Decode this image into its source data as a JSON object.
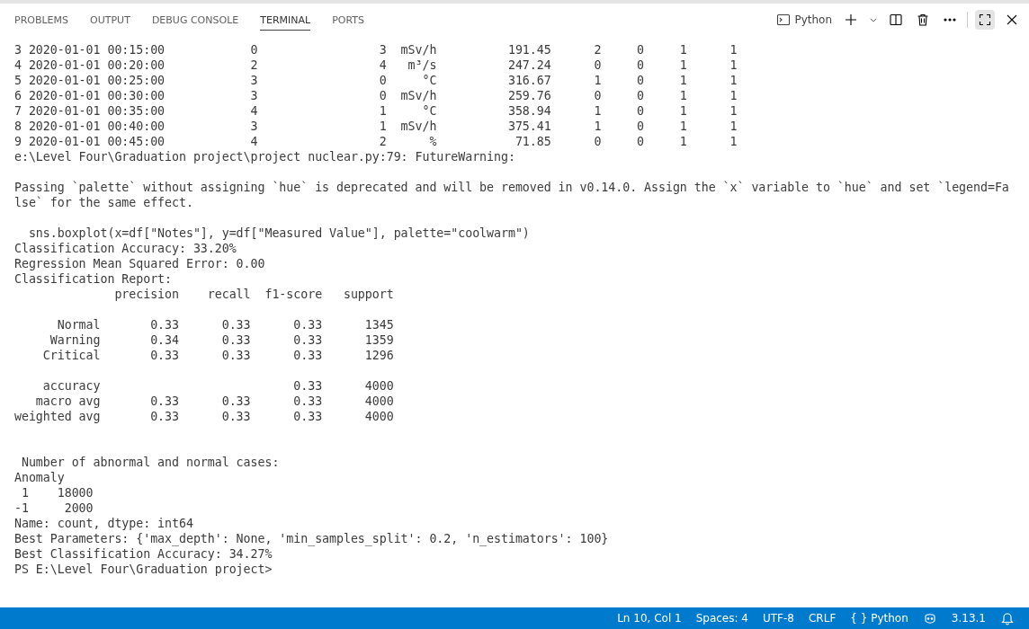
{
  "panel_tabs": [
    {
      "label": "PROBLEMS",
      "selected": false
    },
    {
      "label": "OUTPUT",
      "selected": false
    },
    {
      "label": "DEBUG CONSOLE",
      "selected": false
    },
    {
      "label": "TERMINAL",
      "selected": true
    },
    {
      "label": "PORTS",
      "selected": false
    }
  ],
  "terminal_profile": "Python",
  "terminal_blocks": [
    [
      {
        "text": "3 2020-01-01 00:15:00            0                 3  mSv/h          191.45      2     0     1      1"
      },
      {
        "text": "4 2020-01-01 00:20:00            2                 4   m³/s          247.24      0     0     1      1"
      },
      {
        "text": "5 2020-01-01 00:25:00            3                 0     °C          316.67      1     0     1      1"
      },
      {
        "text": "6 2020-01-01 00:30:00            3                 0  mSv/h          259.76      0     0     1      1"
      },
      {
        "text": "7 2020-01-01 00:35:00            4                 1     °C          358.94      1     0     1      1"
      },
      {
        "text": "8 2020-01-01 00:40:00            3                 1  mSv/h          375.41      1     0     1      1"
      },
      {
        "text": "9 2020-01-01 00:45:00            4                 2      %           71.85      0     0     1      1"
      },
      {
        "text": "e:\\Level Four\\Graduation project\\project nuclear.py:79: FutureWarning:"
      }
    ],
    [
      {
        "text": "Passing `palette` without assigning `hue` is deprecated and will be removed in v0.14.0. Assign the `x` variable to `hue` and set `legend=Fa"
      },
      {
        "text": "lse` for the same effect."
      }
    ],
    [
      {
        "text": "  sns.boxplot(x=df[\"Notes\"], y=df[\"Measured Value\"], palette=\"coolwarm\")"
      },
      {
        "text": "Classification Accuracy: 33.20%"
      },
      {
        "text": "Regression Mean Squared Error: 0.00"
      },
      {
        "text": "Classification Report:"
      },
      {
        "text": "              precision    recall  f1-score   support"
      }
    ],
    [
      {
        "text": "      Normal       0.33      0.33      0.33      1345"
      },
      {
        "text": "     Warning       0.34      0.33      0.33      1359"
      },
      {
        "text": "    Critical       0.33      0.33      0.33      1296"
      }
    ],
    [
      {
        "text": "    accuracy                           0.33      4000"
      },
      {
        "text": "   macro avg       0.33      0.33      0.33      4000"
      },
      {
        "text": "weighted avg       0.33      0.33      0.33      4000"
      }
    ],
    [
      {
        "text": " Number of abnormal and normal cases:"
      },
      {
        "text": "Anomaly"
      },
      {
        "text": " 1    18000"
      },
      {
        "text": "-1     2000"
      },
      {
        "text": "Name: count, dtype: int64"
      },
      {
        "text": "Best Parameters: {'max_depth': None, 'min_samples_split': 0.2, 'n_estimators': 100}"
      },
      {
        "text": "Best Classification Accuracy: 34.27%"
      },
      {
        "text": "PS E:\\Level Four\\Graduation project>"
      }
    ]
  ],
  "status_bar": {
    "position": "Ln 10, Col 1",
    "indentation": "Spaces: 4",
    "encoding": "UTF-8",
    "line_ending": "CRLF",
    "language_braces": "{ }",
    "language": "Python",
    "python_version": "3.13.1"
  }
}
